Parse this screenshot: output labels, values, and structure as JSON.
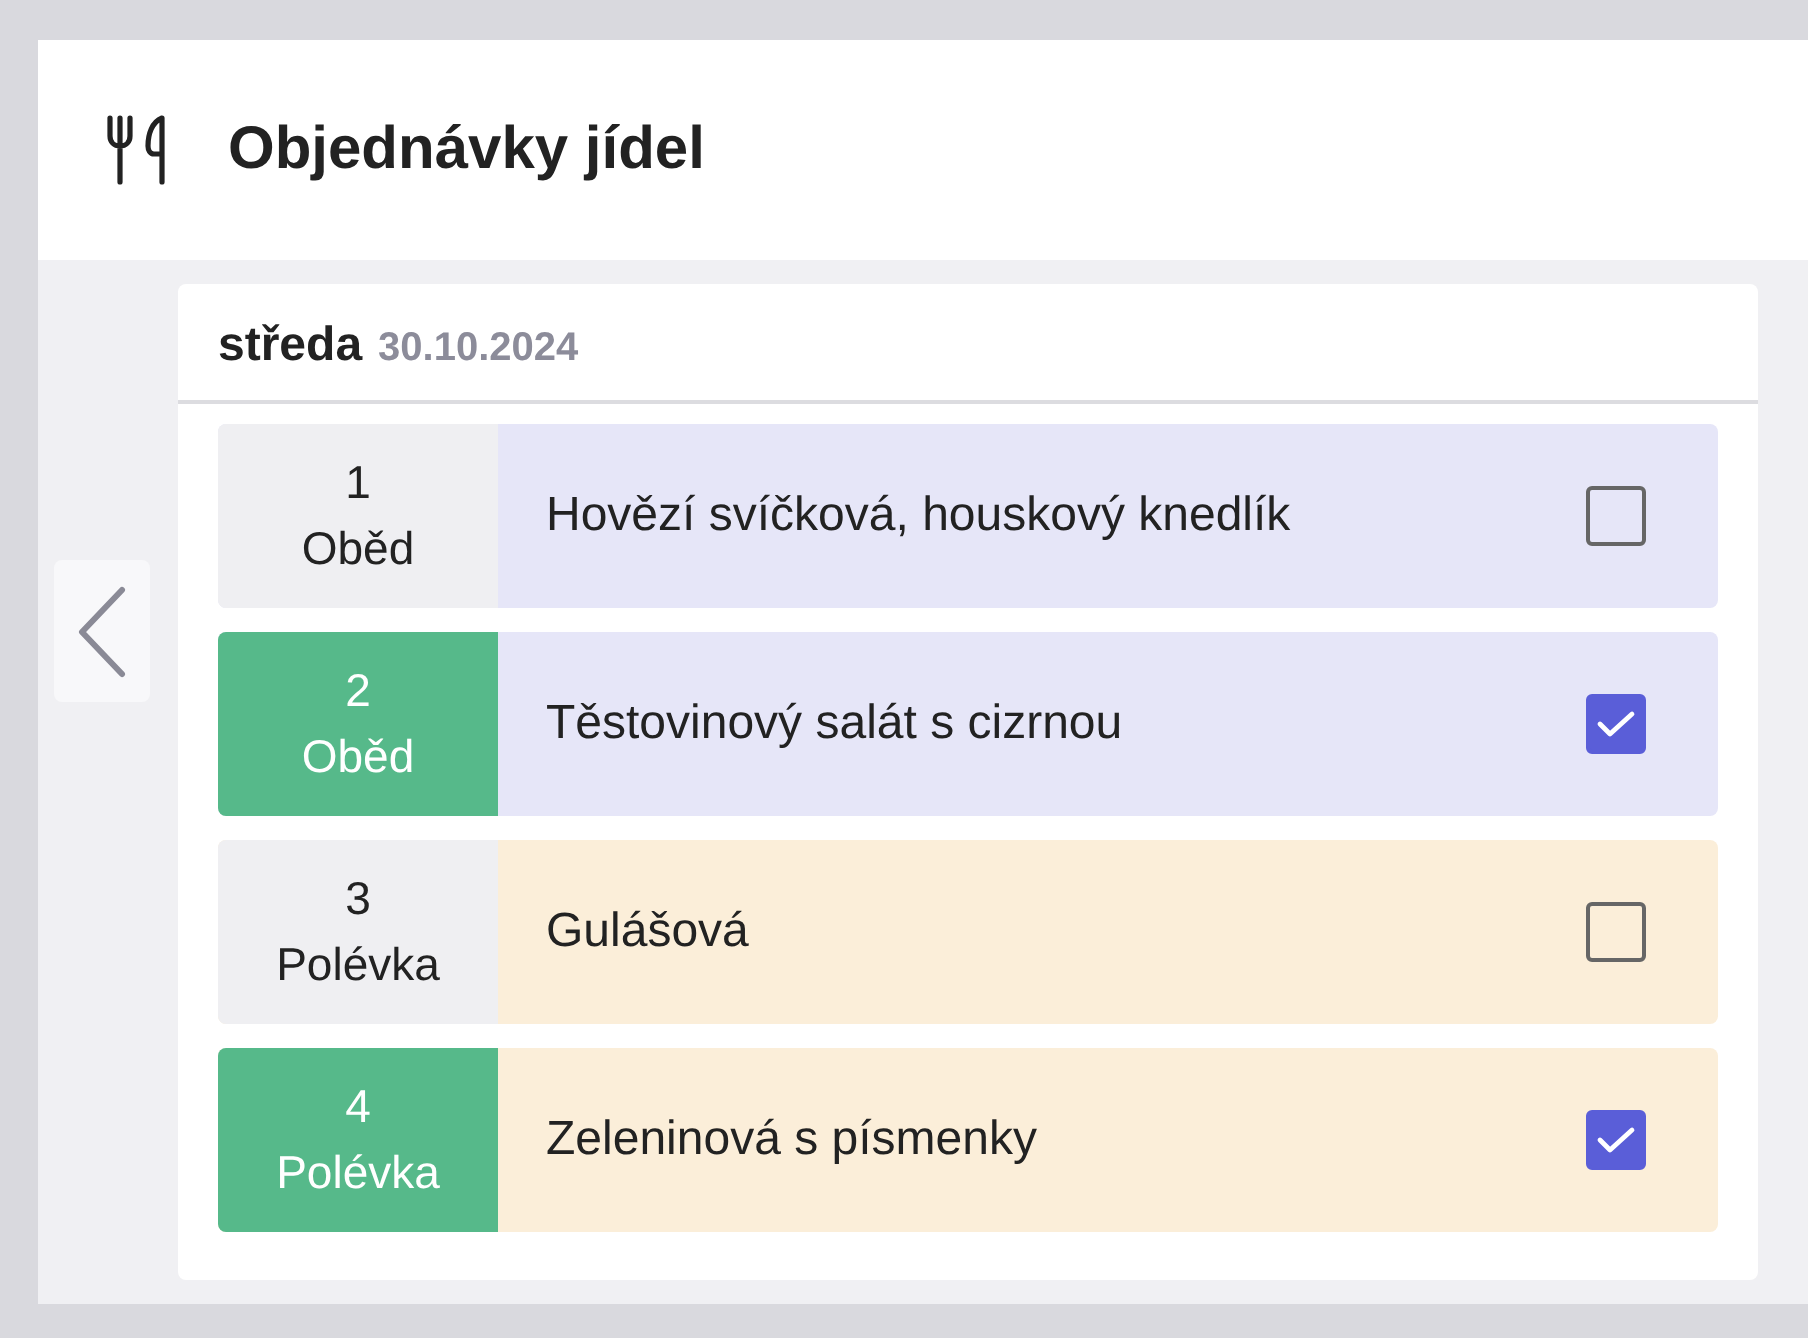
{
  "header": {
    "title": "Objednávky jídel"
  },
  "day": {
    "name": "středa",
    "date": "30.10.2024"
  },
  "meals": [
    {
      "number": "1",
      "type": "Oběd",
      "name": "Hovězí svíčková, houskový knedlík",
      "color": "#e6e6f8",
      "checked": false
    },
    {
      "number": "2",
      "type": "Oběd",
      "name": "Těstovinový salát s cizrnou",
      "color": "#e6e6f8",
      "checked": true
    },
    {
      "number": "3",
      "type": "Polévka",
      "name": "Gulášová",
      "color": "#fbeed9",
      "checked": false
    },
    {
      "number": "4",
      "type": "Polévka",
      "name": "Zeleninová s písmenky",
      "color": "#fbeed9",
      "checked": true
    }
  ]
}
